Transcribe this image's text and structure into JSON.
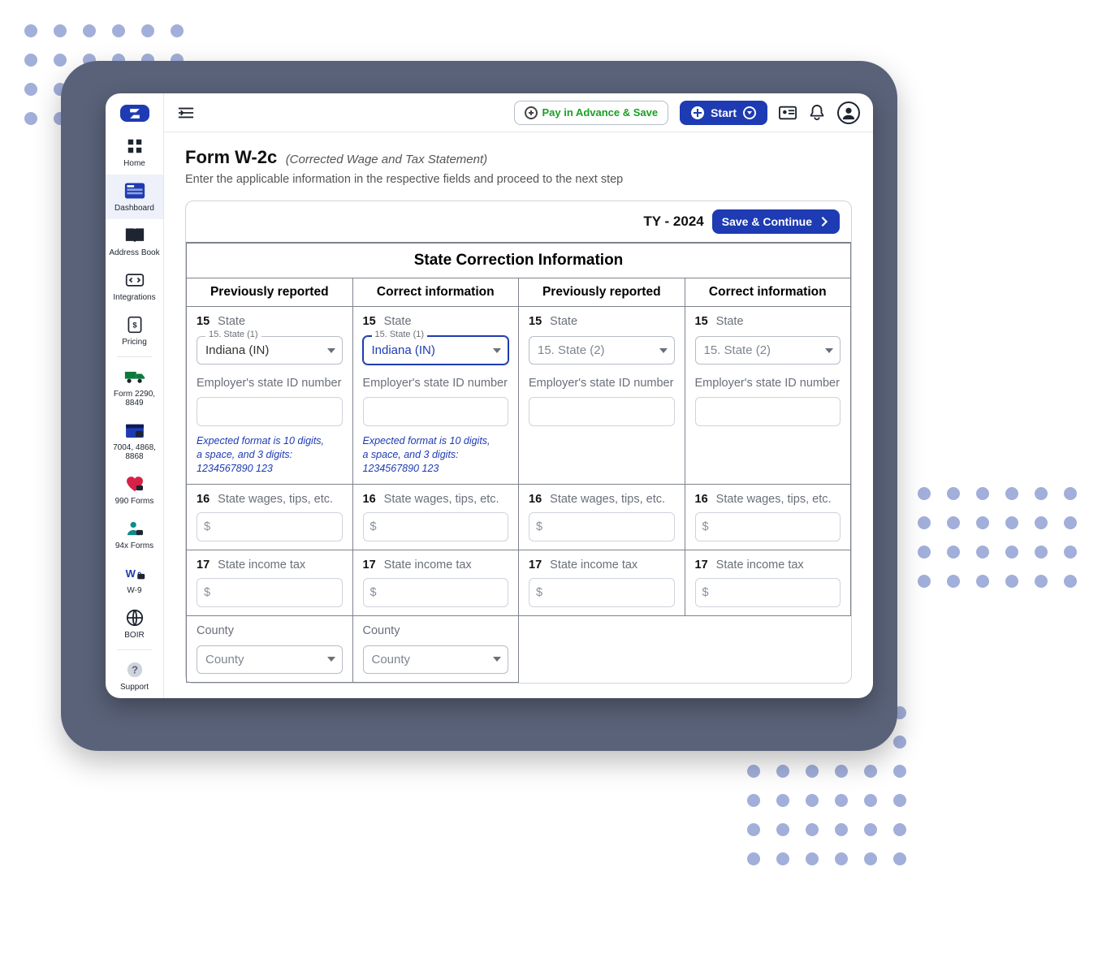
{
  "sidebar": {
    "items": [
      {
        "label": "Home"
      },
      {
        "label": "Dashboard"
      },
      {
        "label": "Address Book"
      },
      {
        "label": "Integrations"
      },
      {
        "label": "Pricing"
      },
      {
        "label": "Form 2290, 8849"
      },
      {
        "label": "7004, 4868, 8868"
      },
      {
        "label": "990 Forms"
      },
      {
        "label": "94x Forms"
      },
      {
        "label": "W-9"
      },
      {
        "label": "BOIR"
      },
      {
        "label": "Support"
      }
    ]
  },
  "topbar": {
    "pay_label": "Pay in Advance & Save",
    "start_label": "Start"
  },
  "page": {
    "title": "Form W-2c",
    "subtitle": "(Corrected Wage and Tax Statement)",
    "description": "Enter the applicable information in the respective fields and proceed to the next step",
    "tax_year": "TY - 2024",
    "save_continue": "Save & Continue"
  },
  "form": {
    "section_title": "State Correction Information",
    "col_prev": "Previously reported",
    "col_corr": "Correct information",
    "hint_lines": {
      "l1": "Expected format is 10 digits,",
      "l2": "a space, and 3 digits:",
      "l3": "1234567890 123"
    },
    "labels": {
      "state": "State",
      "state_leg1": "15. State (1)",
      "state_leg2": "15. State (2)",
      "ein": "Employer's state ID number",
      "wages": "State wages, tips, etc.",
      "tax": "State income tax",
      "county": "County",
      "county_ph": "County",
      "num15": "15",
      "num16": "16",
      "num17": "17",
      "dollar": "$"
    },
    "values": {
      "state1_prev": "Indiana (IN)",
      "state1_corr": "Indiana (IN)",
      "state2_prev_ph": "15. State (2)",
      "state2_corr_ph": "15. State (2)"
    }
  }
}
